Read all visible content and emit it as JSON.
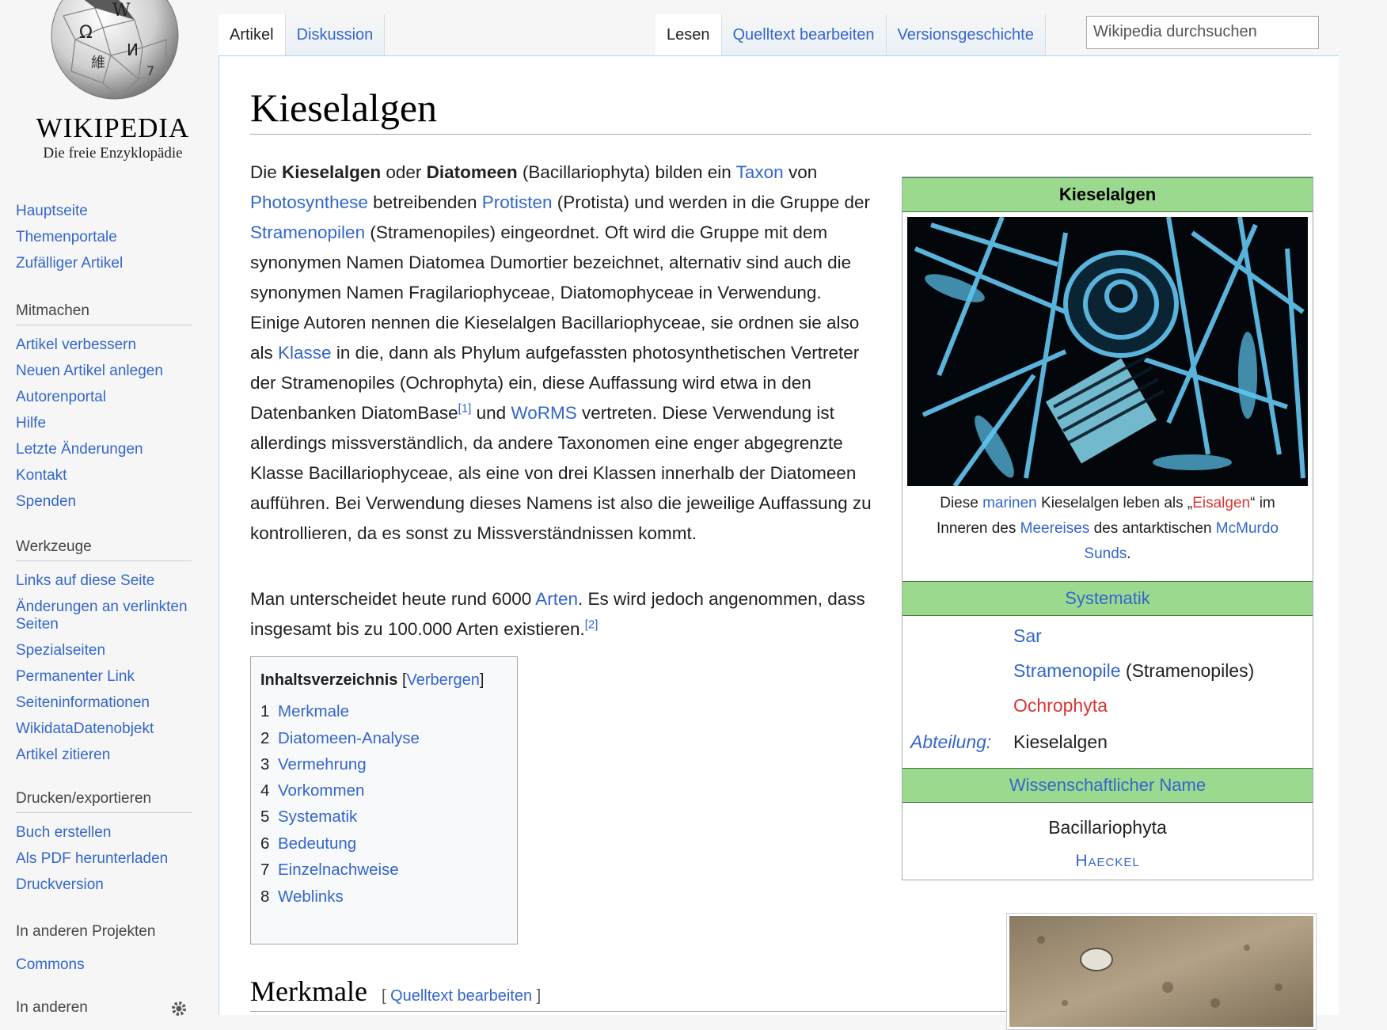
{
  "logo": {
    "wordmark": "WIKIPEDIA",
    "tagline": "Die freie Enzyklopädie"
  },
  "sidebar": {
    "main": [
      "Hauptseite",
      "Themenportale",
      "Zufälliger Artikel"
    ],
    "mitmachen": {
      "heading": "Mitmachen",
      "items": [
        "Artikel verbessern",
        "Neuen Artikel anlegen",
        "Autorenportal",
        "Hilfe",
        "Letzte Änderungen",
        "Kontakt",
        "Spenden"
      ]
    },
    "werkzeuge": {
      "heading": "Werkzeuge",
      "items": [
        "Links auf diese Seite",
        "Änderungen an verlinkten Seiten",
        "Spezialseiten",
        "Permanenter Link",
        "Seiteninformationen",
        "WikidataDatenobjekt",
        "Artikel zitieren"
      ]
    },
    "drucken": {
      "heading": "Drucken/exportieren",
      "items": [
        "Buch erstellen",
        "Als PDF herunterladen",
        "Druckversion"
      ]
    },
    "projekte": {
      "heading": "In anderen Projekten",
      "items": [
        "Commons"
      ]
    },
    "sprachen": {
      "heading": "In anderen"
    }
  },
  "tabs": {
    "artikel": "Artikel",
    "diskussion": "Diskussion",
    "lesen": "Lesen",
    "quelltext": "Quelltext bearbeiten",
    "versionen": "Versionsgeschichte"
  },
  "search": {
    "placeholder": "Wikipedia durchsuchen"
  },
  "article": {
    "title": "Kieselalgen",
    "lead": {
      "t1": "Die ",
      "b1": "Kieselalgen",
      "t2": " oder ",
      "b2": "Diatomeen",
      "t3": " (Bacillariophyta) bilden ein ",
      "l1": "Taxon",
      "t4": " von ",
      "l2": "Photosynthese",
      "t5": " betreibenden ",
      "l3": "Protisten",
      "t6": " (Protista) und werden in die Gruppe der ",
      "l4": "Stramenopilen",
      "t7": " (Stramenopiles) eingeordnet. Oft wird die Gruppe mit dem synonymen Namen Diatomea Dumortier bezeichnet, alternativ sind auch die synonymen Namen Fragilariophyceae, Diatomophyceae in Verwendung. Einige Autoren nennen die Kieselalgen Bacillariophyceae, sie ordnen sie also als ",
      "l5": "Klasse",
      "t8": " in die, dann als Phylum aufgefassten photosynthetischen Vertreter der Stramenopiles (Ochrophyta) ein, diese Auffassung wird etwa in den Datenbanken DiatomBase",
      "ref1": "[1]",
      "t9": " und ",
      "l6": "WoRMS",
      "t10": " vertreten. Diese Verwendung ist allerdings missverständlich, da andere Taxonomen eine enger abgegrenzte Klasse Bacillariophyceae, als eine von drei Klassen innerhalb der Diatomeen aufführen. Bei Verwendung dieses Namens ist also die jeweilige Auffassung zu kontrollieren, da es sonst zu Missverständnissen kommt."
    },
    "lead2": {
      "t1": "Man unterscheidet heute rund 6000 ",
      "l1": "Arten",
      "t2": ". Es wird jedoch angenommen, dass insgesamt bis zu 100.000 Arten existieren.",
      "ref2": "[2]"
    },
    "toc": {
      "title": "Inhaltsverzeichnis",
      "toggle": "Verbergen",
      "items": [
        {
          "num": "1",
          "label": "Merkmale"
        },
        {
          "num": "2",
          "label": "Diatomeen-Analyse"
        },
        {
          "num": "3",
          "label": "Vermehrung"
        },
        {
          "num": "4",
          "label": "Vorkommen"
        },
        {
          "num": "5",
          "label": "Systematik"
        },
        {
          "num": "6",
          "label": "Bedeutung"
        },
        {
          "num": "7",
          "label": "Einzelnachweise"
        },
        {
          "num": "8",
          "label": "Weblinks"
        }
      ]
    },
    "section1": {
      "title": "Merkmale",
      "edit": "Quelltext bearbeiten"
    }
  },
  "infobox": {
    "title": "Kieselalgen",
    "caption": {
      "t1": "Diese ",
      "l1": "marinen",
      "t2": " Kieselalgen leben als „",
      "r1": "Eisalgen",
      "t3": "“ im Inneren des ",
      "l2": "Meereises",
      "t4": " des antarktischen ",
      "l3": "McMurdo Sunds",
      "t5": "."
    },
    "systematik": "Systematik",
    "sys": {
      "sar": "Sar",
      "stramenopile": "Stramenopile",
      "stramenopile_paren": " (Stramenopiles)",
      "ochrophyta": "Ochrophyta",
      "rank": "Abteilung:",
      "abteilung": "Kieselalgen"
    },
    "wiss_heading": "Wissenschaftlicher Name",
    "sci_name": "Bacillariophyta",
    "author": "Haeckel"
  },
  "colors": {
    "link": "#3366cc",
    "redlink": "#dd3333",
    "infobox_band": "#9bd98f"
  }
}
